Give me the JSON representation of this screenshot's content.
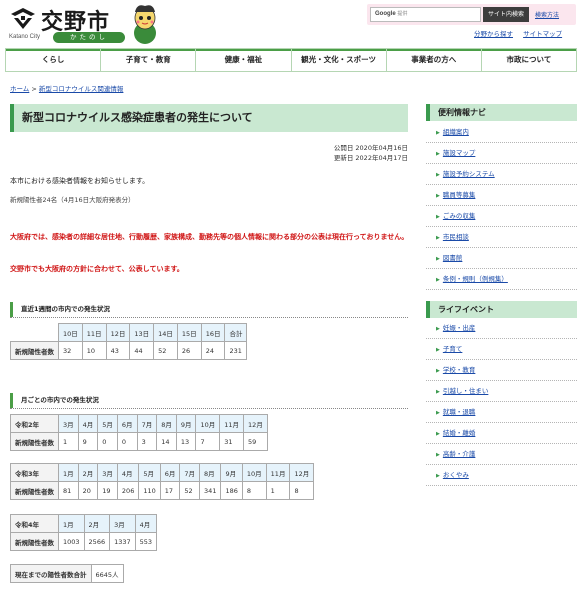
{
  "header": {
    "logo_text": "交野市",
    "logo_en": "Katano City",
    "logo_jp": "かたのし",
    "search_label": "Google",
    "search_sub": "提供",
    "search_button": "サイト内検索",
    "search_help": "検索方法",
    "util_links": [
      "分野から探す",
      "サイトマップ"
    ]
  },
  "nav": [
    "くらし",
    "子育て・教育",
    "健康・福祉",
    "観光・文化・スポーツ",
    "事業者の方へ",
    "市政について"
  ],
  "breadcrumb": {
    "home": "ホーム",
    "sep": " > ",
    "current": "新型コロナウイルス関連情報"
  },
  "page_title": "新型コロナウイルス感染症患者の発生について",
  "dates": {
    "published": "公開日 2020年04月16日",
    "updated": "更新日 2022年04月17日"
  },
  "intro": "本市における感染者情報をお知らせします。",
  "note1": "新規陽性者24名（4月16日大阪府発表分）",
  "red_notes": [
    "大阪府では、感染者の詳細な居住地、行動履歴、家族構成、勤務先等の個人情報に関わる部分の公表は現在行っておりません。",
    "交野市でも大阪府の方針に合わせて、公表しています。"
  ],
  "weekly": {
    "heading": "直近1週間の市内での発生状況",
    "headers": [
      "10日",
      "11日",
      "12日",
      "13日",
      "14日",
      "15日",
      "16日",
      "合計"
    ],
    "row_label": "新規陽性者数",
    "values": [
      "32",
      "10",
      "43",
      "44",
      "52",
      "26",
      "24",
      "231"
    ]
  },
  "monthly": {
    "heading": "月ごとの市内での発生状況",
    "row_label": "新規陽性者数",
    "years": [
      {
        "year": "令和2年",
        "months": [
          "3月",
          "4月",
          "5月",
          "6月",
          "7月",
          "8月",
          "9月",
          "10月",
          "11月",
          "12月"
        ],
        "values": [
          "1",
          "9",
          "0",
          "0",
          "3",
          "14",
          "13",
          "7",
          "31",
          "59"
        ]
      },
      {
        "year": "令和3年",
        "months": [
          "1月",
          "2月",
          "3月",
          "4月",
          "5月",
          "6月",
          "7月",
          "8月",
          "9月",
          "10月",
          "11月",
          "12月"
        ],
        "values": [
          "81",
          "20",
          "19",
          "206",
          "110",
          "17",
          "52",
          "341",
          "186",
          "8",
          "1",
          "8"
        ]
      },
      {
        "year": "令和4年",
        "months": [
          "1月",
          "2月",
          "3月",
          "4月"
        ],
        "values": [
          "1003",
          "2566",
          "1337",
          "553"
        ]
      }
    ]
  },
  "total": {
    "label": "現在までの陽性者数合計",
    "value": "6645人"
  },
  "sidebar": {
    "nav_title": "便利情報ナビ",
    "nav_items": [
      "組織案内",
      "施設マップ",
      "施設予約システム",
      "職員等募集",
      "ごみの収集",
      "市民相談",
      "図書館",
      "条例・規則（例規集）"
    ],
    "life_title": "ライフイベント",
    "life_items": [
      "妊娠・出産",
      "子育て",
      "学校・教育",
      "引越し・住まい",
      "就職・退職",
      "結婚・離婚",
      "高齢・介護",
      "おくやみ"
    ]
  }
}
